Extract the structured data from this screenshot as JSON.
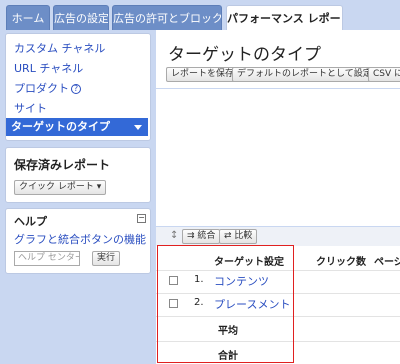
{
  "tabs": [
    "ホーム",
    "広告の設定",
    "広告の許可とブロック",
    "パフォーマンス レポート"
  ],
  "nav": {
    "items": [
      "カスタム チャネル",
      "URL チャネル",
      "プロダクト",
      "サイト"
    ],
    "active": "ターゲットのタイプ"
  },
  "saved": {
    "title": "保存済みレポート",
    "quick_button": "クイック レポート ▾"
  },
  "help": {
    "title": "ヘルプ",
    "minimize": "−",
    "link": "グラフと統合ボタンの機能",
    "search_placeholder": "ヘルプ センターを",
    "go_button": "実行"
  },
  "main": {
    "title": "ターゲットのタイプ",
    "toolbar": [
      "レポートを保存",
      "デフォルトのレポートとして設定",
      "CSV にエクスポート"
    ],
    "sub_toolbar": [
      "統合",
      "比較"
    ]
  },
  "table": {
    "headers": [
      "ターゲット設定",
      "クリック数",
      "ページビュー"
    ],
    "rows": [
      {
        "index": "1.",
        "name": "コンテンツ"
      },
      {
        "index": "2.",
        "name": "プレースメント"
      }
    ],
    "average_label": "平均",
    "total_label": "合計"
  }
}
